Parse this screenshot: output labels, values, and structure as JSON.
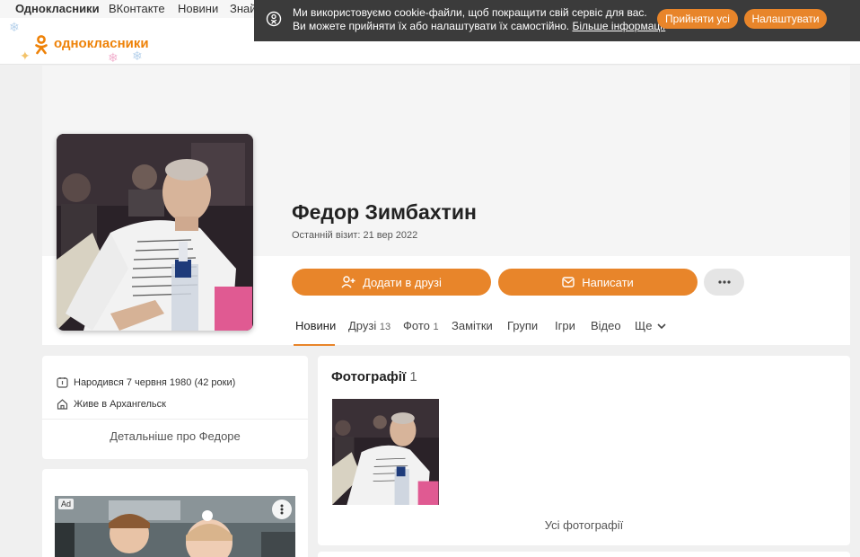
{
  "topnav": {
    "site_name": "Однокласники",
    "links": [
      "ВКонтакте",
      "Новини",
      "Знайомства"
    ]
  },
  "logo": {
    "text": "однокласники",
    "icon": "ok-logo-icon"
  },
  "cookie_banner": {
    "line1": "Ми використовуємо cookie-файли, щоб покращити свій сервіс для вас.",
    "line2": "Ви можете прийняти їх або налаштувати їх самостійно.",
    "link": "Більше інформації",
    "accept_label": "Прийняти усі",
    "settings_label": "Налаштувати",
    "icon": "cookie-icon"
  },
  "profile": {
    "name": "Федор Зимбахтин",
    "last_visit": "Останній візит: 21 вер 2022",
    "add_friend_label": "Додати в друзі",
    "write_label": "Написати",
    "more_icon": "more-dots-icon"
  },
  "tabs": [
    {
      "label": "Новини",
      "count": ""
    },
    {
      "label": "Друзі",
      "count": "13"
    },
    {
      "label": "Фото",
      "count": "1"
    },
    {
      "label": "Замітки",
      "count": ""
    },
    {
      "label": "Групи",
      "count": ""
    },
    {
      "label": "Ігри",
      "count": ""
    },
    {
      "label": "Відео",
      "count": ""
    },
    {
      "label": "Ще",
      "count": ""
    }
  ],
  "info": {
    "born": "Народився 7 червня 1980 (42 роки)",
    "lives": "Живе в Архангельск",
    "more_label": "Детальніше про Федоре"
  },
  "ad": {
    "badge": "Ad"
  },
  "photos": {
    "title": "Фотографії",
    "count": "1",
    "all_label": "Усі фотографії"
  },
  "colors": {
    "accent": "#e8852a",
    "banner": "#3b3b3b",
    "background": "#f0f0f0"
  }
}
